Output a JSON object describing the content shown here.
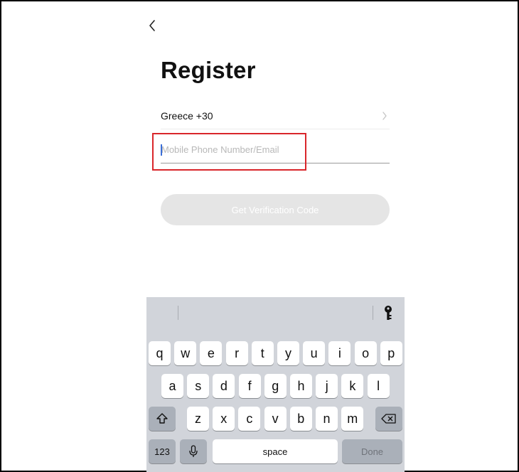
{
  "header": {
    "back_icon": "chevron-left-icon",
    "title": "Register"
  },
  "form": {
    "country_label": "Greece +30",
    "country_chevron_icon": "chevron-right-icon",
    "phone_placeholder": "Mobile Phone Number/Email",
    "phone_value": "",
    "verify_button_label": "Get Verification Code"
  },
  "keyboard": {
    "toolbar_icon": "key-icon",
    "row1": [
      "q",
      "w",
      "e",
      "r",
      "t",
      "y",
      "u",
      "i",
      "o",
      "p"
    ],
    "row2": [
      "a",
      "s",
      "d",
      "f",
      "g",
      "h",
      "j",
      "k",
      "l"
    ],
    "row3": [
      "z",
      "x",
      "c",
      "v",
      "b",
      "n",
      "m"
    ],
    "shift_icon": "shift-icon",
    "delete_icon": "backspace-icon",
    "numbers_label": "123",
    "mic_icon": "microphone-icon",
    "space_label": "space",
    "done_label": "Done"
  },
  "colors": {
    "highlight": "#d9262b",
    "caret": "#3b6fd8",
    "button_disabled": "#e5e5e5",
    "keyboard_bg": "#d1d4da"
  }
}
